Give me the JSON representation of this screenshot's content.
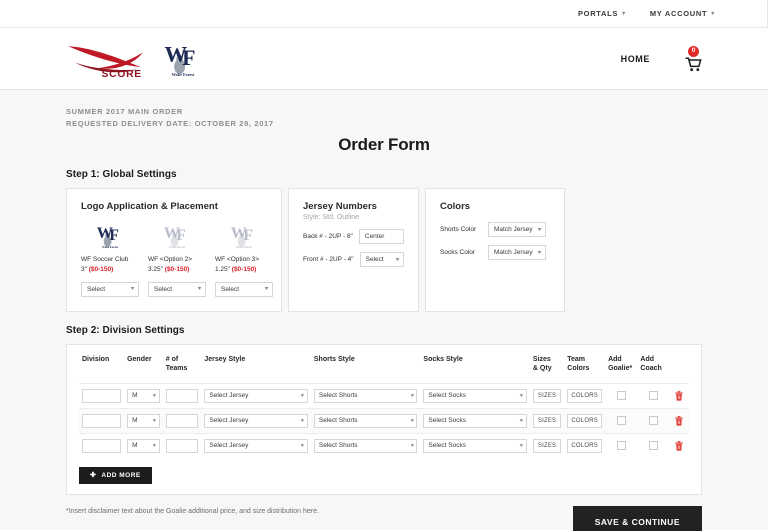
{
  "utility_nav": {
    "items": [
      {
        "label": "PORTALS",
        "icon": "chevron-down-icon"
      },
      {
        "label": "MY ACCOUNT",
        "icon": "chevron-down-icon"
      }
    ]
  },
  "header": {
    "brand_logo": "score-logo",
    "club_logo": "wake-forest-wf-logo",
    "home_label": "HOME",
    "cart_icon": "shopping-cart-icon",
    "cart_count": "0",
    "cart_badge_color": "#e02b28"
  },
  "order_meta": {
    "line1": "SUMMER 2017 MAIN ORDER",
    "line2": "REQUESTED DELIVERY DATE: OCTOBER 29, 2017"
  },
  "page_title": "Order Form",
  "steps": {
    "step1_heading": "Step 1: Global Settings",
    "step2_heading": "Step 2: Division Settings"
  },
  "logo_panel": {
    "title": "Logo Application & Placement",
    "options": [
      {
        "name": "WF Soccer Club",
        "size": "3\"",
        "price": "($0-150)",
        "thumb_icon": "wf-logo-color",
        "select_value": "Select",
        "select_icon": "chevron-down-icon"
      },
      {
        "name": "WF <Option 2>",
        "size": "3.25\"",
        "price": "($0-150)",
        "thumb_icon": "wf-logo-faded",
        "select_value": "Select",
        "select_icon": "chevron-down-icon"
      },
      {
        "name": "WF <Option 3>",
        "size": "1.25\"",
        "price": "($0-150)",
        "thumb_icon": "wf-logo-faded",
        "select_value": "Select",
        "select_icon": "chevron-down-icon"
      }
    ],
    "price_color": "#d81f26"
  },
  "numbers_panel": {
    "title": "Jersey Numbers",
    "subtitle": "Style: Std. Outline",
    "rows": [
      {
        "label": "Back # - 2UP - 8\"",
        "value": "Center",
        "control": "text-input"
      },
      {
        "label": "Front # - 2UP - 4\"",
        "value": "Select",
        "control": "select",
        "icon": "chevron-down-icon"
      }
    ]
  },
  "colors_panel": {
    "title": "Colors",
    "rows": [
      {
        "label": "Shorts Color",
        "value": "Match Jersey",
        "icon": "chevron-down-icon"
      },
      {
        "label": "Socks Color",
        "value": "Match Jersey",
        "icon": "chevron-down-icon"
      }
    ]
  },
  "division_table": {
    "columns": [
      "Division",
      "Gender",
      "# of\nTeams",
      "Jersey Style",
      "Shorts Style",
      "Socks Style",
      "Sizes\n& Qty",
      "Team\nColors",
      "Add\nGoalie*",
      "Add\nCoach"
    ],
    "rows": [
      {
        "division": "",
        "gender": "M",
        "teams": "",
        "jersey": "Select Jersey",
        "shorts": "Select Shorts",
        "socks": "Select Socks",
        "sizes_label": "SIZES",
        "colors_label": "COLORS",
        "add_goalie": false,
        "add_coach": false,
        "delete_icon": "trash-icon"
      },
      {
        "division": "",
        "gender": "M",
        "teams": "",
        "jersey": "Select Jersey",
        "shorts": "Select Shorts",
        "socks": "Select Socks",
        "sizes_label": "SIZES",
        "colors_label": "COLORS",
        "add_goalie": false,
        "add_coach": false,
        "delete_icon": "trash-icon"
      },
      {
        "division": "",
        "gender": "M",
        "teams": "",
        "jersey": "Select Jersey",
        "shorts": "Select Shorts",
        "socks": "Select Socks",
        "sizes_label": "SIZES",
        "colors_label": "COLORS",
        "add_goalie": false,
        "add_coach": false,
        "delete_icon": "trash-icon"
      }
    ],
    "add_more_label": "ADD MORE",
    "add_more_icon": "plus-icon",
    "delete_color": "#e0342e"
  },
  "footer": {
    "disclaimer": "*Insert disclaimer text about the Goalie additional price, and size distribution here.",
    "save_label": "SAVE & CONTINUE"
  }
}
